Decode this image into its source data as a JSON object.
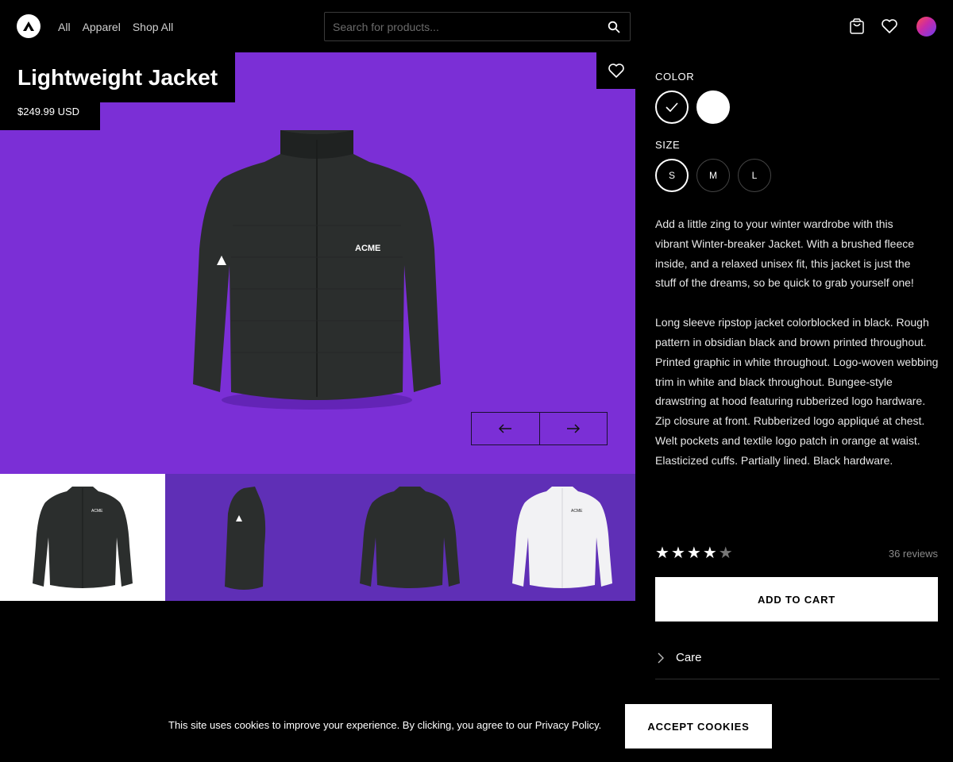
{
  "header": {
    "nav": [
      "All",
      "Apparel",
      "Shop All"
    ],
    "search_placeholder": "Search for products...",
    "icons": [
      "logo-icon",
      "search-icon",
      "cart-icon",
      "heart-icon",
      "avatar"
    ]
  },
  "product": {
    "title": "Lightweight Jacket",
    "price": "$249.99 USD",
    "brand_mark": "ACME",
    "gallery_bg": "#7b2fd6",
    "thumbnails": [
      {
        "view": "front",
        "color": "black",
        "active": true
      },
      {
        "view": "side",
        "color": "black",
        "active": false
      },
      {
        "view": "back",
        "color": "black",
        "active": false
      },
      {
        "view": "front",
        "color": "white",
        "active": false
      }
    ]
  },
  "options": {
    "color_label": "COLOR",
    "colors": [
      {
        "name": "black",
        "hex": "#000000",
        "selected": true
      },
      {
        "name": "white",
        "hex": "#ffffff",
        "selected": false
      }
    ],
    "size_label": "SIZE",
    "sizes": [
      {
        "label": "S",
        "selected": true
      },
      {
        "label": "M",
        "selected": false
      },
      {
        "label": "L",
        "selected": false
      }
    ]
  },
  "description": {
    "p1": "Add a little zing to your winter wardrobe with this vibrant Winter-breaker Jacket. With a brushed fleece inside, and a relaxed unisex fit, this jacket is just the stuff of the dreams, so be quick to grab yourself one!",
    "p2": "Long sleeve ripstop jacket colorblocked in black. Rough pattern in obsidian black and brown printed throughout. Printed graphic in white throughout. Logo-woven webbing trim in white and black throughout. Bungee-style drawstring at hood featuring rubberized logo hardware. Zip closure at front. Rubberized logo appliqué at chest. Welt pockets and textile logo patch in orange at waist. Elasticized cuffs. Partially lined. Black hardware."
  },
  "rating": {
    "stars": 4,
    "max": 5,
    "reviews": "36 reviews"
  },
  "actions": {
    "add_to_cart": "ADD TO CART",
    "care": "Care"
  },
  "cookie": {
    "text": "This site uses cookies to improve your experience. By clicking, you agree to our Privacy Policy.",
    "button": "ACCEPT COOKIES"
  }
}
